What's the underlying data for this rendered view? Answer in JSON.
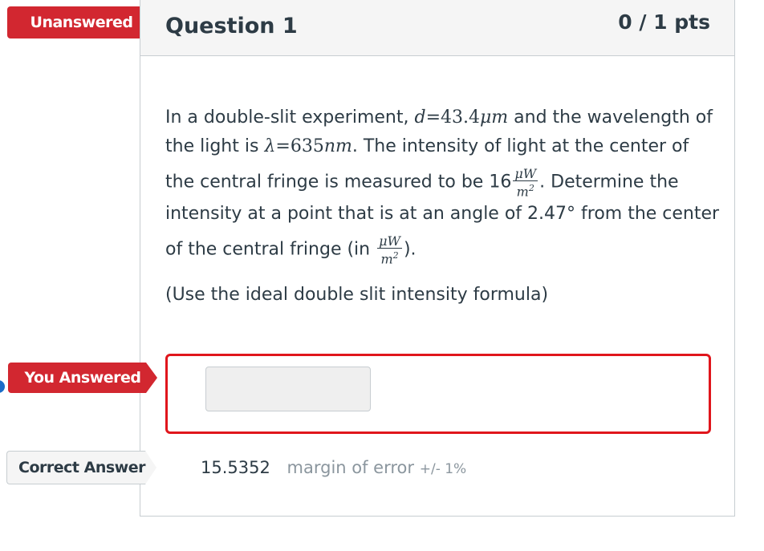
{
  "status": {
    "unanswered_label": "Unanswered",
    "you_answered_label": "You Answered",
    "correct_answer_label": "Correct Answer"
  },
  "question": {
    "title": "Question 1",
    "points": "0 / 1 pts",
    "line1_a": "In a double-slit experiment,",
    "line1_var_d": "d",
    "line1_eq_val": "=43.4",
    "line1_unit": "μm",
    "line1_b": "and the wavelength of",
    "line2_a": "the light is",
    "line2_lambda": "λ",
    "line2_eq_val": "=635",
    "line2_unit": "nm",
    "line2_b": ". The intensity of  light at the center of",
    "line3_a": "the central fringe is measured to  be 16",
    "frac_num": "μW",
    "frac_den": "m",
    "frac_exp": "2",
    "line3_b": ". Determine the",
    "line4": "intensity at a point that is at an angle of  2.47° from the  center",
    "line5_a": "of the central fringe (in",
    "line5_b": ").",
    "note": "(Use the  ideal double slit intensity formula)"
  },
  "answer": {
    "user_value": "",
    "correct_value": "15.5352",
    "margin_label": "margin of error",
    "margin_value": "+/- 1%"
  },
  "colors": {
    "red_ribbon": "#d22730",
    "answer_border": "#e0161c",
    "text": "#2d3b45",
    "muted": "#8b969e"
  }
}
